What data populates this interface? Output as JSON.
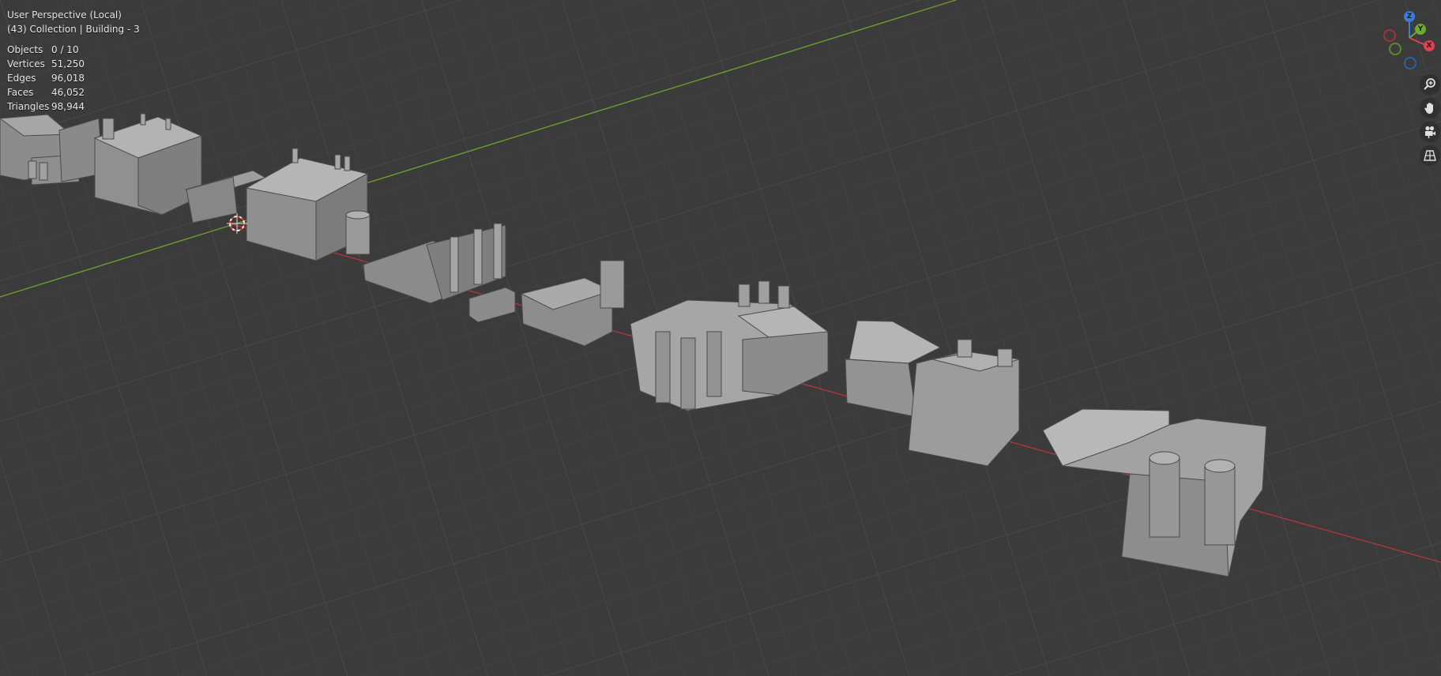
{
  "viewport": {
    "view_name": "User Perspective (Local)",
    "collection_info": "(43) Collection | Building - 3",
    "stats": [
      {
        "key": "Objects",
        "value": "0 / 10"
      },
      {
        "key": "Vertices",
        "value": "51,250"
      },
      {
        "key": "Edges",
        "value": "96,018"
      },
      {
        "key": "Faces",
        "value": "46,052"
      },
      {
        "key": "Triangles",
        "value": "98,944"
      }
    ]
  },
  "gizmo": {
    "axes": [
      {
        "label": "Z",
        "color": "#3b7be0",
        "name": "z-axis-handle"
      },
      {
        "label": "Y",
        "color": "#6cab2c",
        "name": "y-axis-handle"
      },
      {
        "label": "X",
        "color": "#e0404f",
        "name": "x-axis-handle"
      }
    ]
  },
  "tools": [
    {
      "name": "zoom-icon",
      "label": "Zoom"
    },
    {
      "name": "hand-pan-icon",
      "label": "Pan"
    },
    {
      "name": "camera-view-icon",
      "label": "Camera"
    },
    {
      "name": "grid-perspective-icon",
      "label": "Toggle Perspective"
    }
  ],
  "colors": {
    "background": "#3b3b3b",
    "grid_line": "#444444",
    "x_axis": "#b8363f",
    "y_axis": "#6d9e2a",
    "model": "#9a9a9a"
  }
}
